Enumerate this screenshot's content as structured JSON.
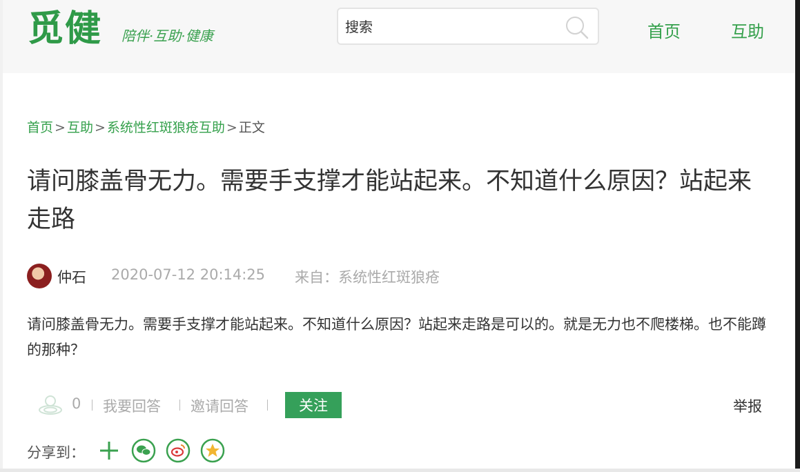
{
  "header": {
    "logo": "觅健",
    "slogan": "陪伴·互助·健康",
    "search_placeholder": "搜索",
    "nav": [
      "首页",
      "互助"
    ]
  },
  "breadcrumb": {
    "items": [
      "首页",
      "互助",
      "系统性红斑狼疮互助"
    ],
    "separator": ">",
    "current": "正文"
  },
  "post": {
    "title": "请问膝盖骨无力。需要手支撑才能站起来。不知道什么原因？站起来走路",
    "author": "仲石",
    "datetime": "2020-07-12 20:14:25",
    "source": "来自：系统性红斑狼疮",
    "body": "请问膝盖骨无力。需要手支撑才能站起来。不知道什么原因？站起来走路是可以的。就是无力也不爬楼梯。也不能蹲的那种？"
  },
  "actions": {
    "like_count": "0",
    "answer": "我要回答",
    "invite": "邀请回答",
    "follow": "关注",
    "report": "举报"
  },
  "share": {
    "label": "分享到：",
    "icons": [
      "plus-icon",
      "wechat-icon",
      "weibo-icon",
      "qzone-icon"
    ]
  },
  "colors": {
    "brand_green": "#34a04b",
    "button_green": "#35a05a"
  }
}
